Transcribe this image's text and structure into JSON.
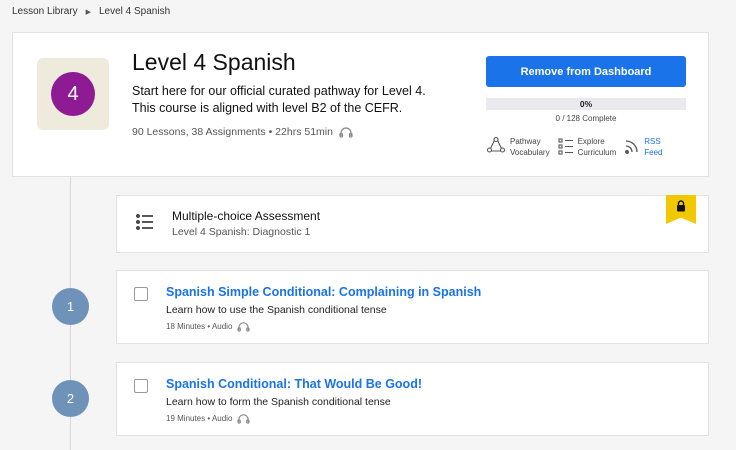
{
  "breadcrumb": {
    "root": "Lesson Library",
    "current": "Level 4 Spanish"
  },
  "course": {
    "level_number": "4",
    "title": "Level 4 Spanish",
    "description": "Start here for our official curated pathway for Level 4. This course is aligned with level B2 of the CEFR.",
    "meta": "90 Lessons, 38 Assignments • 22hrs 51min",
    "remove_label": "Remove from Dashboard",
    "progress_percent": 0,
    "progress_label": "0%",
    "progress_caption": "0 / 128 Complete",
    "actions": [
      {
        "line1": "Pathway",
        "line2": "Vocabulary",
        "icon": "pathway-icon"
      },
      {
        "line1": "Explore",
        "line2": "Curriculum",
        "icon": "curriculum-list-icon"
      },
      {
        "line1": "RSS",
        "line2": "Feed",
        "icon": "rss-icon"
      }
    ],
    "colors": {
      "level": "#8e1b94",
      "accent": "#1a73e8"
    }
  },
  "assessment": {
    "title": "Multiple-choice Assessment",
    "subtitle": "Level 4 Spanish: Diagnostic 1",
    "locked": true,
    "lock_color": "#f2c800"
  },
  "lessons": [
    {
      "number": "1",
      "title": "Spanish Simple Conditional: Complaining in Spanish",
      "description": "Learn how to use the Spanish conditional tense",
      "meta": "18 Minutes • Audio"
    },
    {
      "number": "2",
      "title": "Spanish Conditional: That Would Be Good!",
      "description": "Learn how to form the Spanish conditional tense",
      "meta": "19 Minutes • Audio"
    }
  ]
}
